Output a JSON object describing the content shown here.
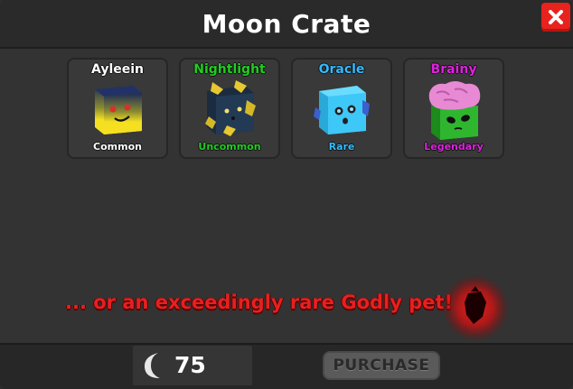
{
  "window": {
    "title": "Moon Crate"
  },
  "pets": [
    {
      "name": "Ayleein",
      "rarity": "Common",
      "name_color": "#ffffff",
      "rarity_color": "#ffffff"
    },
    {
      "name": "Nightlight",
      "rarity": "Uncommon",
      "name_color": "#22cc22",
      "rarity_color": "#22cc22"
    },
    {
      "name": "Oracle",
      "rarity": "Rare",
      "name_color": "#33bbff",
      "rarity_color": "#33bbff"
    },
    {
      "name": "Brainy",
      "rarity": "Legendary",
      "name_color": "#dd22dd",
      "rarity_color": "#dd22dd"
    }
  ],
  "footer": {
    "godly_text": "... or an exceedingly rare Godly pet!",
    "price": "75",
    "currency_icon": "moon-icon",
    "purchase_label": "PURCHASE"
  },
  "colors": {
    "close_button": "#e8221c",
    "godly_text": "#e62020",
    "purchase_button": "#5a5a5a"
  }
}
